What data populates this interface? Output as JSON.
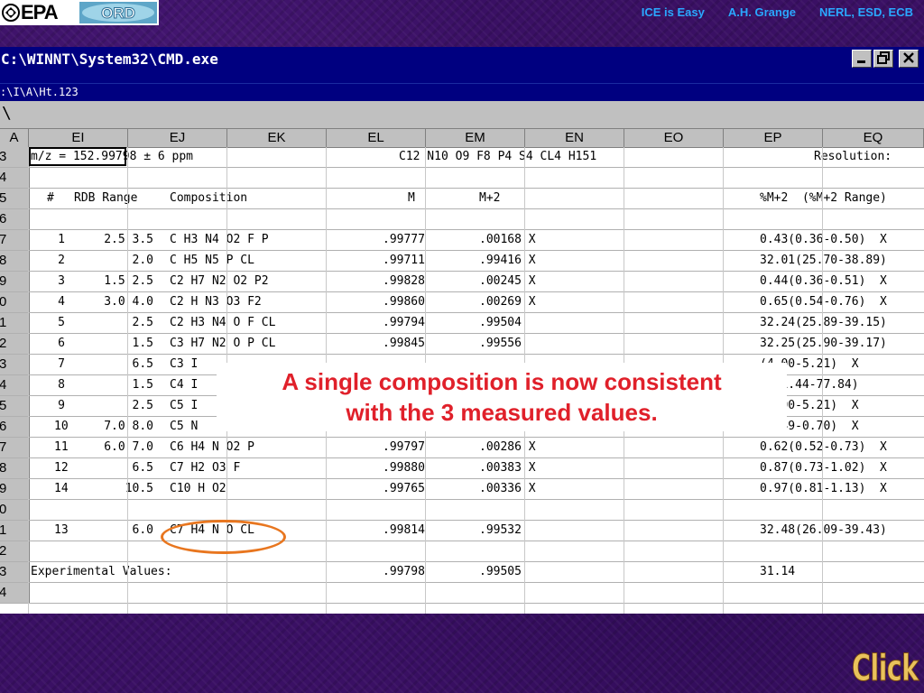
{
  "header": {
    "epa_logo": "EPA",
    "ord_logo": "ORD",
    "links": [
      "ICE is Easy",
      "A.H. Grange",
      "NERL, ESD, ECB"
    ]
  },
  "cmd_window": {
    "title": "C:\\WINNT\\System32\\CMD.exe",
    "buttons": {
      "minimize": "_",
      "maximize": "Ȣ",
      "close": "✕"
    },
    "sheet_title": ":\\I\\A\\Ht.123",
    "formula_bar": "\\"
  },
  "grid": {
    "columns": [
      "A",
      "EI",
      "EJ",
      "EK",
      "EL",
      "EM",
      "EN",
      "EO",
      "EP",
      "EQ"
    ],
    "rows": [
      {
        "num": "3",
        "cells": [
          "m/z = 152.99798 ± 6 ppm",
          "C12 N10 O9 F8 P4 S4 CL4 H151",
          "Resolution:"
        ]
      },
      {
        "num": "4",
        "cells": []
      },
      {
        "num": "5",
        "cells": [
          "#",
          "RDB Range",
          "Composition",
          "M",
          "M+2",
          "%M+2  (%M+2 Range)"
        ]
      },
      {
        "num": "6",
        "cells": []
      },
      {
        "num": "7",
        "cells": [
          "1",
          "2.5 3.5",
          "C H3 N4 O2 F P",
          ".99777",
          ".00168 X",
          "0.43(0.36-0.50)  X"
        ]
      },
      {
        "num": "8",
        "cells": [
          "2",
          "2.0",
          "C H5 N5 P CL",
          ".99711",
          ".99416 X",
          "32.01(25.70-38.89)"
        ]
      },
      {
        "num": "9",
        "cells": [
          "3",
          "1.5 2.5",
          "C2 H7 N2 O2 P2",
          ".99828",
          ".00245 X",
          "0.44(0.36-0.51)  X"
        ]
      },
      {
        "num": "0",
        "cells": [
          "4",
          "3.0 4.0",
          "C2 H N3 O3 F2",
          ".99860",
          ".00269 X",
          "0.65(0.54-0.76)  X"
        ]
      },
      {
        "num": "1",
        "cells": [
          "5",
          "2.5",
          "C2 H3 N4 O F CL",
          ".99794",
          ".99504",
          "32.24(25.89-39.15)"
        ]
      },
      {
        "num": "2",
        "cells": [
          "6",
          "1.5",
          "C3 H7 N2 O P CL",
          ".99845",
          ".99556",
          "32.25(25.90-39.17)"
        ]
      },
      {
        "num": "3",
        "cells": [
          "7",
          "6.5",
          "C3 I",
          "",
          "",
          "(4.00-5.21)  X"
        ]
      },
      {
        "num": "4",
        "cells": [
          "8",
          "1.5",
          "C4 I",
          "",
          "",
          "5(51.44-77.84)"
        ]
      },
      {
        "num": "5",
        "cells": [
          "9",
          "2.5",
          "C5 I",
          "",
          "",
          "(4.00-5.21)  X"
        ]
      },
      {
        "num": "6",
        "cells": [
          "10",
          "7.0 8.0",
          "C5 N",
          "",
          "",
          "(0.49-0.70)  X"
        ]
      },
      {
        "num": "7",
        "cells": [
          "11",
          "6.0 7.0",
          "C6 H4 N O2 P",
          ".99797",
          ".00286 X",
          "0.62(0.52-0.73)  X"
        ]
      },
      {
        "num": "8",
        "cells": [
          "12",
          "6.5",
          "C7 H2 O3 F",
          ".99880",
          ".00383 X",
          "0.87(0.73-1.02)  X"
        ]
      },
      {
        "num": "9",
        "cells": [
          "14",
          "10.5",
          "C10 H O2",
          ".99765",
          ".00336 X",
          "0.97(0.81-1.13)  X"
        ]
      },
      {
        "num": "0",
        "cells": []
      },
      {
        "num": "1",
        "cells": [
          "13",
          "6.0",
          "C7 H4 N O CL",
          ".99814",
          ".99532",
          "32.48(26.09-39.43)"
        ]
      },
      {
        "num": "2",
        "cells": []
      },
      {
        "num": "3",
        "cells": [
          "Experimental Values:",
          ".99798",
          ".99505",
          "31.14"
        ]
      },
      {
        "num": "4",
        "cells": []
      }
    ]
  },
  "callout": {
    "line1": "A single composition is now consistent",
    "line2": "with the 3 measured values."
  },
  "click_label": "Click",
  "colors": {
    "background": "#3a1064",
    "title_bar": "#000080",
    "header_link": "#2aa8ff",
    "callout_text": "#e0202a",
    "highlight_ellipse": "#e8761f",
    "click_label": "#e9c25c"
  }
}
